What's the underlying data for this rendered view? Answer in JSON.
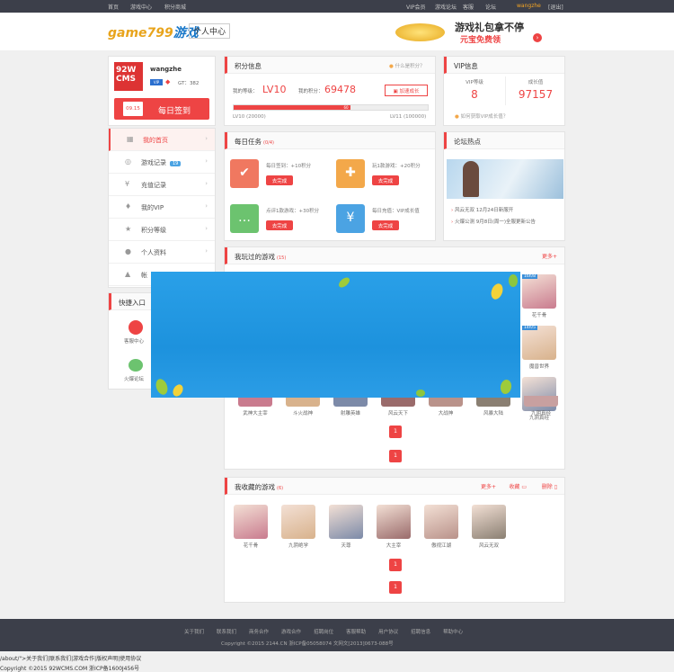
{
  "topbar": {
    "links": [
      "首页",
      "游戏中心",
      "积分商城"
    ],
    "right_links": [
      "VIP会员",
      "游戏论坛",
      "客服",
      "论坛"
    ],
    "user": "wangzhe",
    "logout": "[退出]"
  },
  "header": {
    "logo_a": "game799",
    "logo_b": "游戏",
    "center": "个人中心",
    "banner_line1": "游戏礼包拿不停",
    "banner_line2": "元宝免费领"
  },
  "profile": {
    "avatar_text": "92W CMS",
    "name": "wangzhe",
    "gold_label": "GT：",
    "gold": "382",
    "date": "09.15",
    "signin": "每日签到"
  },
  "nav": [
    {
      "label": "我的首页",
      "icon": "home-icon",
      "glyph": "▦"
    },
    {
      "label": "游戏记录",
      "icon": "gamepad-icon",
      "glyph": "◎",
      "badge": "19"
    },
    {
      "label": "充值记录",
      "icon": "coin-icon",
      "glyph": "¥"
    },
    {
      "label": "我的VIP",
      "icon": "shield-icon",
      "glyph": "♦"
    },
    {
      "label": "积分等级",
      "icon": "star-icon",
      "glyph": "★"
    },
    {
      "label": "个人资料",
      "icon": "user-icon",
      "glyph": "●"
    },
    {
      "label": "帐",
      "icon": "lock-icon",
      "glyph": "▲"
    }
  ],
  "quick": {
    "title": "快捷入口",
    "items": [
      "客服中心",
      "火爆论坛"
    ]
  },
  "points": {
    "title": "积分信息",
    "help": "什么是积分？",
    "level_label": "我的等级：",
    "level": "LV10",
    "points_label": "我的积分：",
    "points": "69478",
    "boost": "加速成长",
    "progress": 0.6,
    "progress_text": "60",
    "lv_from": "LV10 (20000)",
    "lv_to": "LV11 (100000)"
  },
  "vip": {
    "title": "VIP信息",
    "level_label": "VIP等级",
    "level": "8",
    "growth_label": "成长值",
    "growth": "97157",
    "link": "如何获取VIP成长值？"
  },
  "tasks": {
    "title": "每日任务",
    "sub": "(0/4)",
    "items": [
      {
        "text": "每日签到：+10积分",
        "btn": "去完成",
        "color": "#f07860",
        "glyph": "✔"
      },
      {
        "text": "玩1款游戏：+20积分",
        "btn": "去完成",
        "color": "#f3a84a",
        "glyph": "✚"
      },
      {
        "text": "点评1款游戏：+30积分",
        "btn": "去完成",
        "color": "#6cc36f",
        "glyph": "…"
      },
      {
        "text": "每日充值：VIP成长值",
        "btn": "去完成",
        "color": "#4ba3e3",
        "glyph": "¥"
      }
    ]
  },
  "forum": {
    "title": "论坛热点",
    "posts": [
      "风云无双 12月24日新服开",
      "火爆公测 9月8日(周一)全服更新公告"
    ]
  },
  "played": {
    "title": "我玩过的游戏",
    "sub": "(15)",
    "more": "更多+",
    "right_games": [
      {
        "name": "花千骨",
        "tag": "16h/8"
      },
      {
        "name": "魔兽世界",
        "tag": "14h/5"
      },
      {
        "name": "九阴真经",
        "tag": ""
      }
    ],
    "bottom_games": [
      "武神大主宰",
      "斗火战神",
      "射雕英雄",
      "风云天下",
      "大战神",
      "风暴大陆",
      "九阴真经"
    ],
    "pages": [
      "1",
      "1"
    ]
  },
  "fav": {
    "title": "我收藏的游戏",
    "sub": "(6)",
    "more": "更多+",
    "collect": "收藏",
    "delete": "删除",
    "games": [
      "花千骨",
      "九阴绝学",
      "天尊",
      "大主宰",
      "傲视江湖",
      "风云无双"
    ],
    "pages": [
      "1",
      "1"
    ]
  },
  "footer": {
    "links": [
      "关于我们",
      "联系我们",
      "商务合作",
      "游戏合作",
      "招聘岗位",
      "客服帮助",
      "用户协议",
      "招聘信息",
      "帮助中心"
    ],
    "copyright": "Copyright ©2015 2144.CN 浙ICP备05058074 文网文[2013]0673-088号"
  },
  "bottom": {
    "line1": "/about/\">关于我们|联系我们|游戏合作|版权声明|使用协议",
    "line2": "Copyright ©2015 92WCMS.COM 浙ICP备1600J456号"
  }
}
